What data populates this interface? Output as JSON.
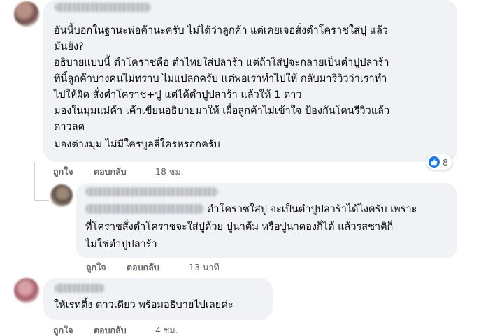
{
  "colors": {
    "bubble": "#f0f2f5",
    "meta_text": "#65676b",
    "like_blue": "#1877f2"
  },
  "comments": [
    {
      "lines": [
        "อันนี้บอกในฐานะพ่อค้านะครับ ไม่ได้ว่าลูกค้า แต่เคยเจอสั่งตำโคราชใส่ปู แล้ว",
        "มันยัง?",
        "อธิบายแบบนี้ ตำโคราชคือ ตำไทยใส่ปลาร้า แต่ถ้าใส่ปูจะกลายเป็นตำปูปลาร้า",
        "ทีนี้ลูกค้าบางคนไม่ทราบ ไม่แปลกครับ แต่พอเราทำไปให้ กลับมารีวิวว่าเราทำ",
        "ไปให้ผิด สั่งตำโคราช+ปู แต่ได้ตำปูปลาร้า แล้วให้ 1 ดาว",
        "มองในมุมแม่ค้า เค้าเขียนอธิบายมาให้ เผื่อลูกค้าไม่เข้าใจ ป้องกันโดนรีวิวแล้ว",
        "ดาวลด",
        "มองต่างมุม ไม่มีใครบูลลี่ใครหรอกครับ"
      ],
      "like_label": "ถูกใจ",
      "reply_label": "ตอบกลับ",
      "time": "18 ชม.",
      "reaction_count": "8",
      "reaction_icon": "like-icon"
    },
    {
      "lines": [
        "ตำโคราชใส่ปู จะเป็นตำปูปลาร้าได้ไงครับ เพราะ",
        "ที่โคราชสั่งตำโคราชจะใส่ปูด้วย ปูนาต้ม หรือปูนาดองก็ได้ แล้วรสชาติก็",
        "ไม่ใช่ตำปูปลาร้า"
      ],
      "like_label": "ถูกใจ",
      "reply_label": "ตอบกลับ",
      "time": "13 นาที"
    },
    {
      "lines": [
        "ให้เรทติ้ง ดาวเดียว พร้อมอธิบายไปเลยค่ะ"
      ],
      "like_label": "ถูกใจ",
      "reply_label": "ตอบกลับ",
      "time": "4 ชม."
    }
  ]
}
